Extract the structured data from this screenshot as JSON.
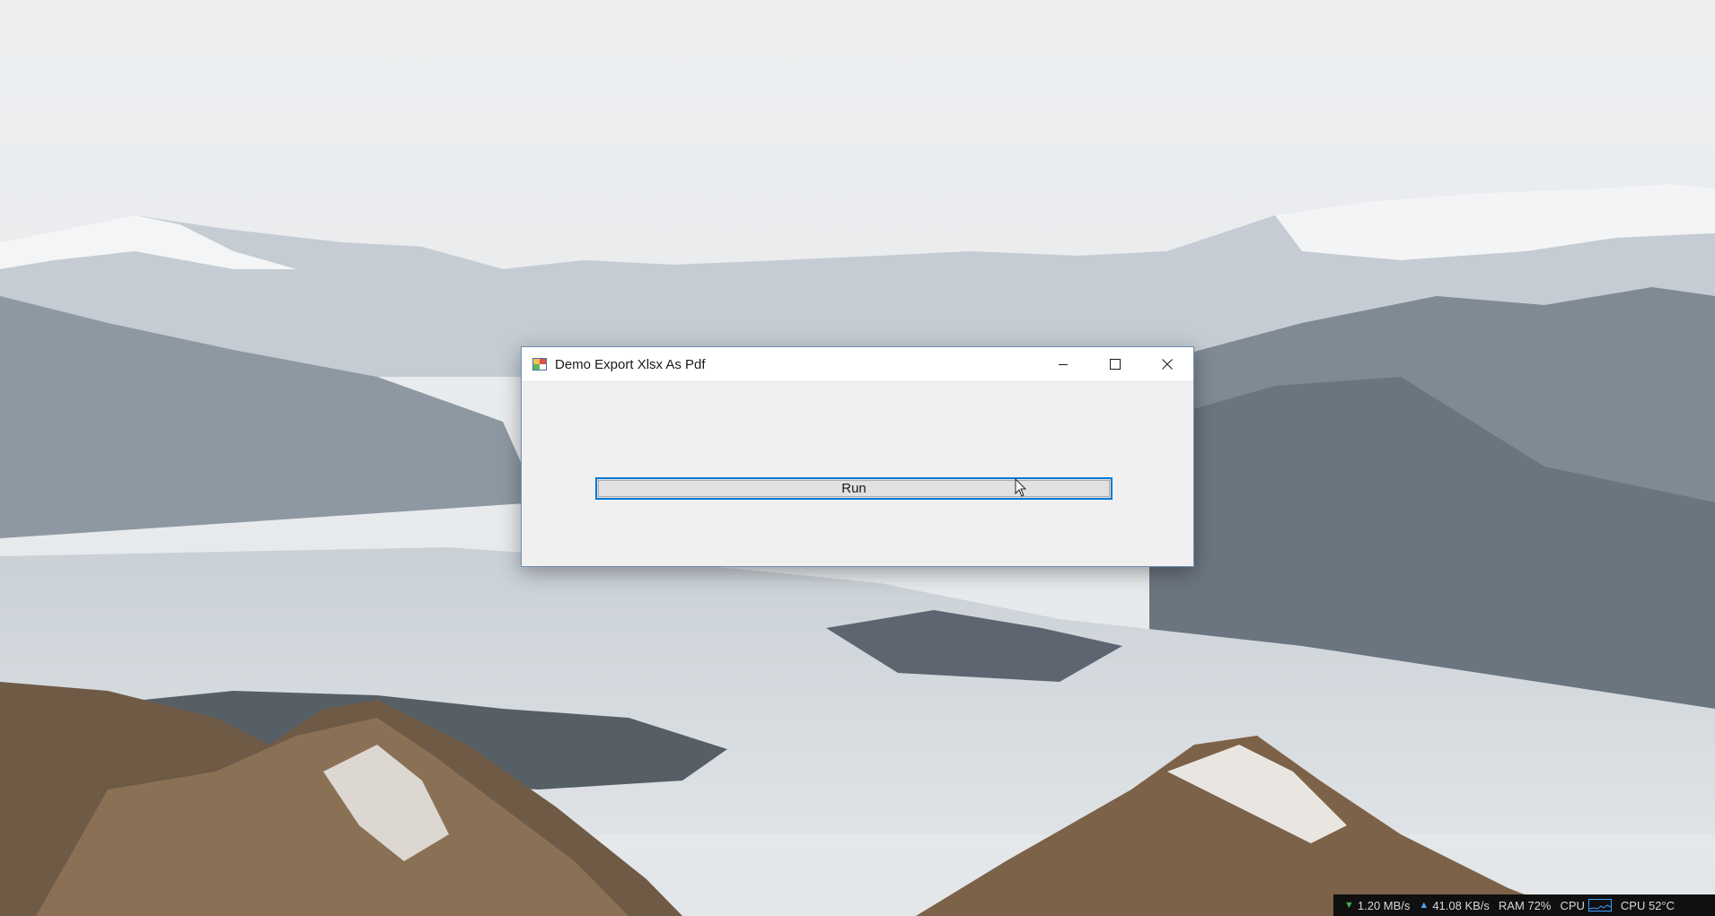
{
  "window": {
    "title": "Demo Export Xlsx As Pdf",
    "icon": "app-icon",
    "controls": {
      "minimize_icon": "minimize-icon",
      "maximize_icon": "maximize-icon",
      "close_icon": "close-icon"
    }
  },
  "main": {
    "run_label": "Run"
  },
  "tray": {
    "download": "1.20 MB/s",
    "upload": "41.08 KB/s",
    "ram": "RAM 72%",
    "cpu_label": "CPU",
    "cpu_temp": "CPU 52°C"
  },
  "colors": {
    "accent": "#0078d7",
    "button_face": "#e1e1e1",
    "window_bg": "#f0f0f0"
  }
}
